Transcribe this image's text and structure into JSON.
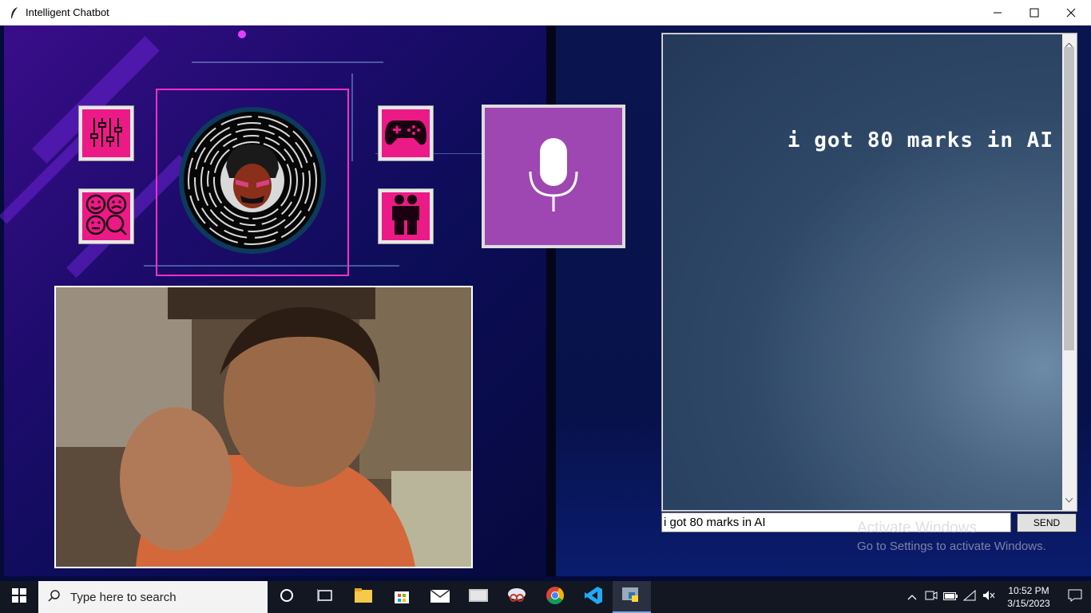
{
  "window": {
    "title": "Intelligent Chatbot",
    "controls": [
      "minimize",
      "maximize",
      "close"
    ]
  },
  "side_buttons": [
    {
      "icon": "settings-sliders-icon"
    },
    {
      "icon": "emotions-icon"
    },
    {
      "icon": "gamepad-icon"
    },
    {
      "icon": "friends-icon"
    }
  ],
  "mic": {
    "icon": "microphone-icon"
  },
  "chat": {
    "message": "i got 80 marks in AI",
    "input_value": "i got 80 marks in AI",
    "send_label": "SEND"
  },
  "watermark": {
    "line1": "Activate Windows",
    "line2": "Go to Settings to activate Windows."
  },
  "taskbar": {
    "search_placeholder": "Type here to search",
    "time": "10:52 PM",
    "date": "3/15/2023",
    "apps": [
      "cortana-icon",
      "task-view-icon",
      "file-explorer-icon",
      "store-icon",
      "mail-icon",
      "photos-icon",
      "snip-icon",
      "chrome-icon",
      "vscode-icon",
      "python-icon"
    ]
  },
  "colors": {
    "accent_pink": "#ec1a86",
    "mic_purple": "#9e46b2",
    "frame_magenta": "#ff2fc8"
  }
}
